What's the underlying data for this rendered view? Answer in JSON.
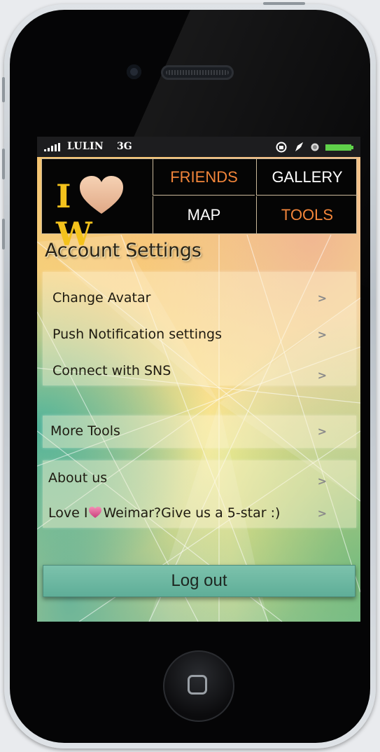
{
  "status_bar": {
    "carrier": "LULIN",
    "network": "3G",
    "icons": [
      "signal-bars-icon",
      "rotation-lock-icon",
      "location-arrow-icon",
      "alarm-clock-icon",
      "battery-icon"
    ],
    "battery_color": "#5fd14a"
  },
  "logo": {
    "left_letter": "I",
    "right_letter": "W",
    "heart_icon": "heart-icon",
    "letter_color": "#f4c21c"
  },
  "nav": {
    "tabs": [
      {
        "label": "FRIENDS",
        "highlighted": true
      },
      {
        "label": "GALLERY",
        "highlighted": false
      },
      {
        "label": "MAP",
        "highlighted": false
      },
      {
        "label": "TOOLS",
        "highlighted": true
      }
    ],
    "highlight_color": "#f2853a"
  },
  "page_title": "Account Settings",
  "account_items": [
    {
      "label": "Change Avatar",
      "chevron": ">"
    },
    {
      "label": "Push Notification settings",
      "chevron": ">"
    },
    {
      "label": "Connect with SNS",
      "chevron": ">"
    }
  ],
  "more_tools": {
    "label": "More Tools",
    "chevron": ">"
  },
  "about_items": [
    {
      "label": "About us",
      "chevron": ">"
    },
    {
      "label_prefix": "Love I",
      "label_suffix": "Weimar?Give us a 5-star :)",
      "inline_icon": "heart-icon",
      "chevron": ">"
    }
  ],
  "logout": {
    "label": "Log out",
    "color": "#6fbaa3"
  }
}
